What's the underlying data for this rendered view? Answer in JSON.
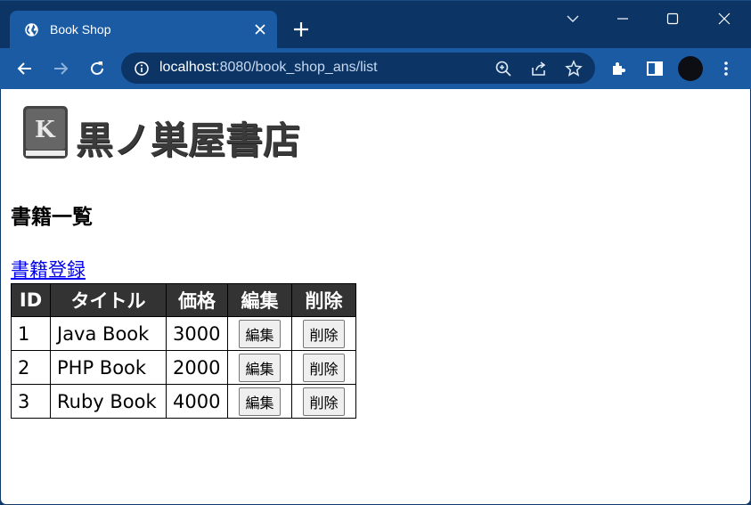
{
  "browser": {
    "tab_title": "Book Shop",
    "url_host": "localhost",
    "url_path": ":8080/book_shop_ans/list",
    "icons": [
      "globe-icon",
      "close-icon",
      "plus-icon",
      "chevron-down-icon",
      "minimize-icon",
      "maximize-icon",
      "close-window-icon",
      "back-icon",
      "forward-icon",
      "reload-icon",
      "info-icon",
      "zoom-icon",
      "share-icon",
      "star-icon",
      "extensions-icon",
      "side-panel-icon",
      "menu-icon"
    ]
  },
  "page": {
    "logo_text": "黒ノ巣屋書店",
    "logo_letter": "K",
    "heading": "書籍一覧",
    "register_link": "書籍登録",
    "table": {
      "headers": [
        "ID",
        "タイトル",
        "価格",
        "編集",
        "削除"
      ],
      "rows": [
        {
          "id": "1",
          "title": "Java Book",
          "price": "3000",
          "edit": "編集",
          "delete": "削除"
        },
        {
          "id": "2",
          "title": "PHP Book",
          "price": "2000",
          "edit": "編集",
          "delete": "削除"
        },
        {
          "id": "3",
          "title": "Ruby Book",
          "price": "4000",
          "edit": "編集",
          "delete": "削除"
        }
      ]
    }
  },
  "colors": {
    "chrome_dark": "#0c3566",
    "chrome_tab": "#1a5ba3",
    "table_header": "#333333",
    "link": "#0000ee"
  }
}
